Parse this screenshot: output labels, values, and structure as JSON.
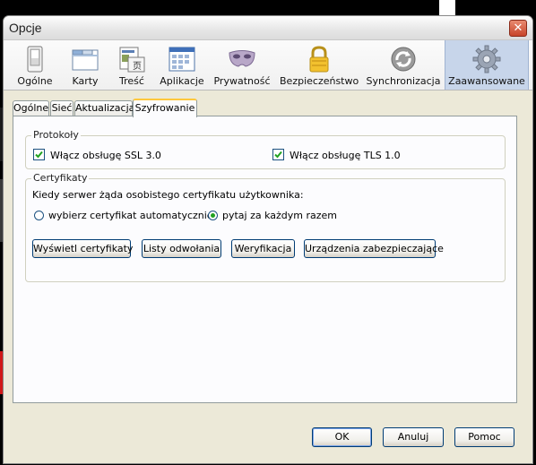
{
  "window": {
    "title": "Opcje",
    "close_glyph": "✕"
  },
  "toolbar": {
    "panes": [
      {
        "label": "Ogólne",
        "icon": "general-switch-icon"
      },
      {
        "label": "Karty",
        "icon": "tabs-window-icon"
      },
      {
        "label": "Treść",
        "icon": "content-page-icon"
      },
      {
        "label": "Aplikacje",
        "icon": "applications-icon"
      },
      {
        "label": "Prywatność",
        "icon": "privacy-mask-icon"
      },
      {
        "label": "Bezpieczeństwo",
        "icon": "security-padlock-icon"
      },
      {
        "label": "Synchronizacja",
        "icon": "sync-icon"
      },
      {
        "label": "Zaawansowane",
        "icon": "advanced-gear-icon"
      }
    ],
    "active": "Zaawansowane"
  },
  "tabs": [
    "Ogólne",
    "Sieć",
    "Aktualizacja",
    "Szyfrowanie"
  ],
  "active_tab": "Szyfrowanie",
  "protocols": {
    "legend": "Protokoły",
    "ssl": {
      "label": "Włącz obsługę SSL 3.0",
      "checked": true
    },
    "tls": {
      "label": "Włącz obsługę TLS 1.0",
      "checked": true
    }
  },
  "certificates": {
    "legend": "Certyfikaty",
    "prompt": "Kiedy serwer żąda osobistego certyfikatu użytkownika:",
    "option_auto": {
      "label": "wybierz certyfikat automatycznie",
      "selected": false
    },
    "option_ask": {
      "label": "pytaj za każdym razem",
      "selected": true
    },
    "buttons": {
      "view": "Wyświetl certyfikaty",
      "revocation": "Listy odwołania",
      "verification": "Weryfikacja",
      "devices": "Urządzenia zabezpieczające"
    }
  },
  "footer": {
    "ok": "OK",
    "cancel": "Anuluj",
    "help": "Pomoc"
  },
  "colors": {
    "active_pane": "#c7d5ea",
    "tab_highlight": "#ffc83c",
    "check_green": "#21a121"
  }
}
